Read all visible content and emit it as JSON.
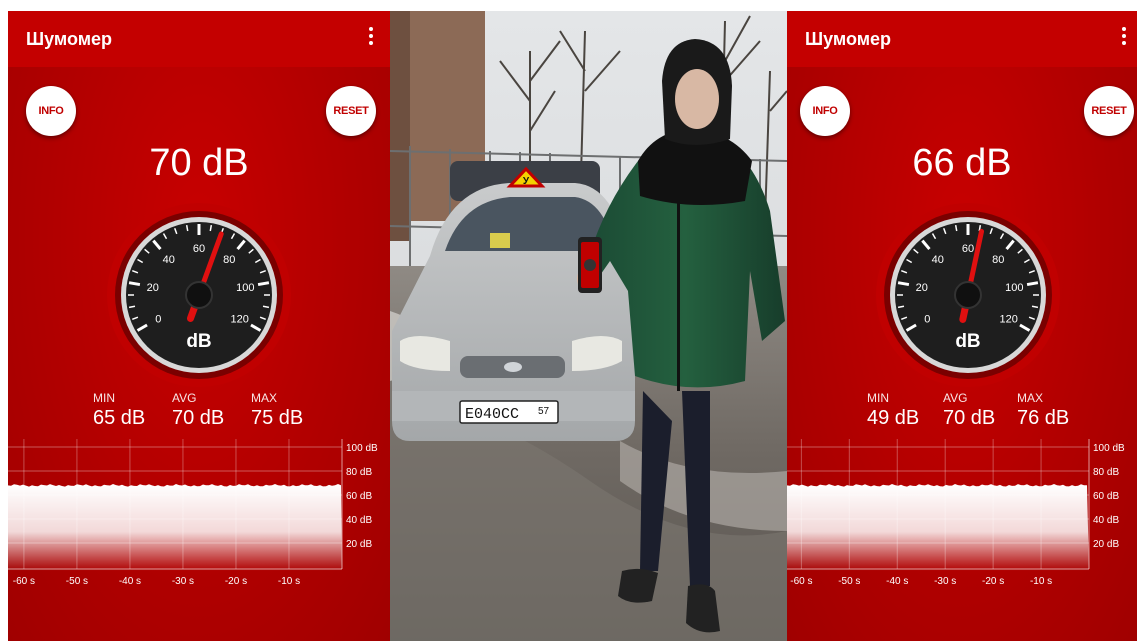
{
  "left_screen": {
    "app_title": "Шумомер",
    "info_label": "INFO",
    "reset_label": "RESET",
    "reading": "70 dB",
    "gauge_value_db": 70,
    "gauge_unit": "dB",
    "gauge_ticks": [
      "0",
      "20",
      "40",
      "60",
      "80",
      "100",
      "120"
    ],
    "stats": {
      "min_label": "MIN",
      "min_value": "65 dB",
      "avg_label": "AVG",
      "avg_value": "70 dB",
      "max_label": "MAX",
      "max_value": "75 dB"
    },
    "graph": {
      "y_labels": [
        "100 dB",
        "80 dB",
        "60 dB",
        "40 dB",
        "20 dB"
      ],
      "x_labels": [
        "-60 s",
        "-50 s",
        "-40 s",
        "-30 s",
        "-20 s",
        "-10 s"
      ],
      "level_db": 68
    }
  },
  "right_screen": {
    "app_title": "Шумомер",
    "info_label": "INFO",
    "reset_label": "RESET",
    "reading": "66 dB",
    "gauge_value_db": 66,
    "gauge_unit": "dB",
    "gauge_ticks": [
      "0",
      "20",
      "40",
      "60",
      "80",
      "100",
      "120"
    ],
    "stats": {
      "min_label": "MIN",
      "min_value": "49 dB",
      "avg_label": "AVG",
      "avg_value": "70 dB",
      "max_label": "MAX",
      "max_value": "76 dB"
    },
    "graph": {
      "y_labels": [
        "100 dB",
        "80 dB",
        "60 dB",
        "40 dB",
        "20 dB"
      ],
      "x_labels": [
        "-60 s",
        "-50 s",
        "-40 s",
        "-30 s",
        "-20 s",
        "-10 s"
      ],
      "level_db": 68
    }
  },
  "photo": {
    "plate_text": "Е040СС",
    "plate_region": "57",
    "sign_letter": "У"
  },
  "colors": {
    "app_red": "#b20000",
    "appbar_red": "#c40000",
    "needle_red": "#e01010",
    "button_white": "#ffffff"
  }
}
